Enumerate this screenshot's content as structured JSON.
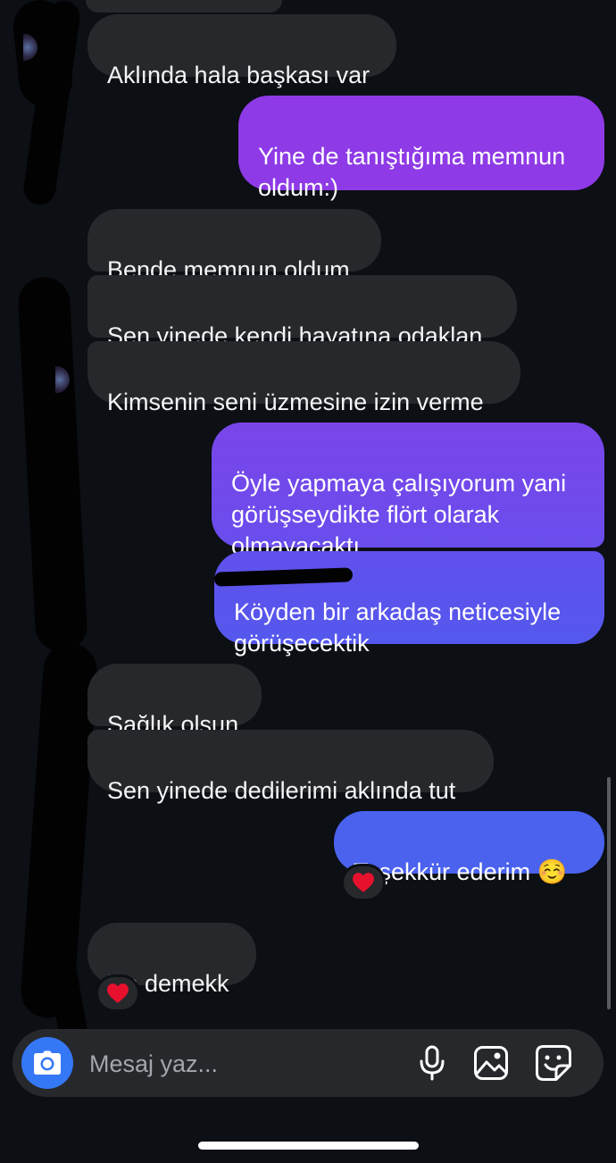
{
  "colors": {
    "background": "#0c0f14",
    "incoming_bubble": "#26282c",
    "outgoing_gradient": [
      "#8e3ae6",
      "#7a45ea",
      "#5f55ec",
      "#4a62ee"
    ],
    "camera_button": "#3578f5",
    "reaction_heart": "#e8112d"
  },
  "messages": [
    {
      "direction": "incoming",
      "text": "Aklında hala başkası var"
    },
    {
      "direction": "outgoing",
      "text": "Yine de tanıştığıma memnun\noldum:)"
    },
    {
      "direction": "incoming",
      "text": "Bende memnun oldum"
    },
    {
      "direction": "incoming",
      "text": "Sen yinede kendi hayatına odaklan"
    },
    {
      "direction": "incoming",
      "text": "Kimsenin seni üzmesine izin verme"
    },
    {
      "direction": "outgoing",
      "text": "Öyle yapmaya çalışıyorum yani\ngörüşseydikte flört olarak\nolmayacaktı"
    },
    {
      "direction": "outgoing",
      "text": "Köyden bir arkadaş neticesiyle\ngörüşecektik"
    },
    {
      "direction": "incoming",
      "text": "Sağlık olsun"
    },
    {
      "direction": "incoming",
      "text": "Sen yinede dedilerimi aklında tut"
    },
    {
      "direction": "outgoing",
      "text": "Teşekkür ederim ☺️",
      "reaction": "heart-icon"
    },
    {
      "direction": "incoming",
      "text": "Ne demekk",
      "reaction": "heart-icon"
    }
  ],
  "composer": {
    "placeholder": "Mesaj yaz...",
    "icons": [
      "camera-icon",
      "microphone-icon",
      "gallery-icon",
      "sticker-icon"
    ]
  }
}
